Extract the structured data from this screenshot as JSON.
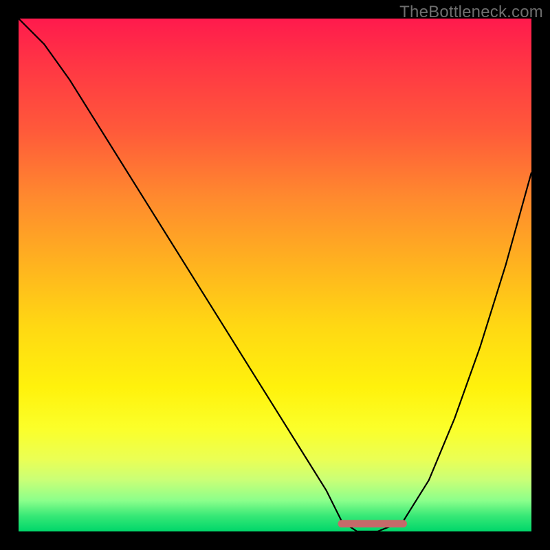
{
  "attribution": "TheBottleneck.com",
  "chart_data": {
    "type": "line",
    "title": "",
    "xlabel": "",
    "ylabel": "",
    "xlim": [
      0,
      100
    ],
    "ylim": [
      0,
      100
    ],
    "grid": false,
    "series": [
      {
        "name": "bottleneck-curve",
        "x": [
          0,
          5,
          10,
          15,
          20,
          25,
          30,
          35,
          40,
          45,
          50,
          55,
          60,
          63,
          66,
          70,
          75,
          80,
          85,
          90,
          95,
          100
        ],
        "y": [
          100,
          95,
          88,
          80,
          72,
          64,
          56,
          48,
          40,
          32,
          24,
          16,
          8,
          2,
          0,
          0,
          2,
          10,
          22,
          36,
          52,
          70
        ],
        "stroke": "#000000",
        "stroke_width": 2.2
      },
      {
        "name": "sweet-spot-band",
        "x": [
          63,
          75
        ],
        "y": [
          1.5,
          1.5
        ],
        "stroke": "#c56a6a",
        "stroke_width": 11,
        "linecap": "round"
      }
    ],
    "legend": {
      "visible": false
    }
  },
  "colors": {
    "frame": "#000000",
    "attribution_text": "#6e6e6e",
    "curve": "#000000",
    "sweet_spot": "#c56a6a"
  }
}
